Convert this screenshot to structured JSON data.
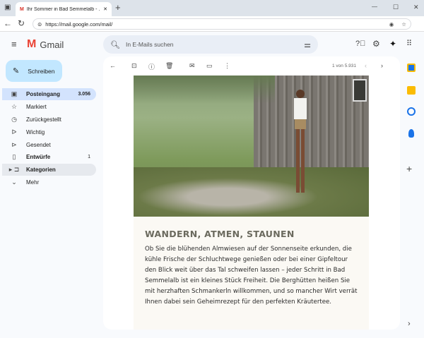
{
  "browser": {
    "tab_title": "Ihr Sommer in Bad Semmelalb - ...",
    "url": "https://mail.google.com/mail/",
    "new_tab": "+",
    "close_tab": "✕",
    "minimize": "—",
    "maximize": "☐",
    "close": "✕"
  },
  "gmail": {
    "logo_text": "Gmail",
    "search_placeholder": "In E-Mails suchen",
    "compose_label": "Schreiben"
  },
  "sidebar": {
    "items": [
      {
        "label": "Posteingang",
        "count": "3.056",
        "icon": "inbox-icon",
        "active": true,
        "bold": true
      },
      {
        "label": "Markiert",
        "count": "",
        "icon": "star-icon"
      },
      {
        "label": "Zurückgestellt",
        "count": "",
        "icon": "clock-icon"
      },
      {
        "label": "Wichtig",
        "count": "",
        "icon": "important-icon"
      },
      {
        "label": "Gesendet",
        "count": "",
        "icon": "send-icon"
      },
      {
        "label": "Entwürfe",
        "count": "1",
        "icon": "draft-icon",
        "bold": true
      },
      {
        "label": "Kategorien",
        "count": "",
        "icon": "label-icon",
        "bold": true
      },
      {
        "label": "Mehr",
        "count": "",
        "icon": "chevron-down-icon"
      }
    ]
  },
  "toolbar": {
    "pagination": "1 von 5.931"
  },
  "email": {
    "heading": "WANDERN, ATMEN, STAUNEN",
    "body": "Ob Sie die blühenden Almwiesen auf der Sonnenseite erkunden, die kühle Frische der Schluchtwege genießen oder bei einer Gipfeltour den Blick weit über das Tal schweifen lassen – jeder Schritt in Bad Semmelalb ist ein kleines Stück Freiheit. Die Berghütten heißen Sie mit herzhaften Schmankerln willkommen, und so mancher Wirt verrät Ihnen dabei sein Geheimrezept für den perfekten Kräutertee."
  },
  "colors": {
    "accent": "#c2e7ff",
    "active_nav": "#d3e3fd",
    "bg": "#f8fafd"
  }
}
